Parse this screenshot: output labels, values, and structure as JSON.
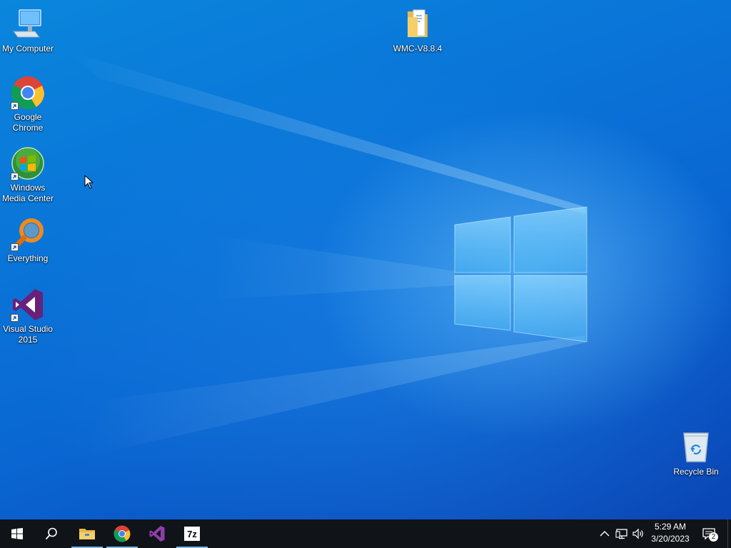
{
  "desktop": {
    "icons": [
      {
        "name": "my-computer",
        "label": "My Computer",
        "icon": "computer-icon"
      },
      {
        "name": "google-chrome",
        "label": "Google\nChrome",
        "icon": "chrome-icon"
      },
      {
        "name": "windows-media-center",
        "label": "Windows\nMedia Center",
        "icon": "windows-media-center-icon"
      },
      {
        "name": "everything",
        "label": "Everything",
        "icon": "magnifier-icon"
      },
      {
        "name": "visual-studio-2015",
        "label": "Visual Studio\n2015",
        "icon": "visual-studio-icon"
      },
      {
        "name": "wmc-folder",
        "label": "WMC-V8.8.4",
        "icon": "folder-icon"
      },
      {
        "name": "recycle-bin",
        "label": "Recycle Bin",
        "icon": "recycle-bin-icon"
      }
    ],
    "wallpaper_color": "#0a6fd6"
  },
  "taskbar": {
    "start_icon": "windows-logo-icon",
    "search_icon": "search-icon",
    "pinned": [
      {
        "name": "file-explorer",
        "icon": "folder-icon",
        "running": true
      },
      {
        "name": "google-chrome",
        "icon": "chrome-icon",
        "running": true
      },
      {
        "name": "visual-studio",
        "icon": "visual-studio-icon",
        "running": false
      },
      {
        "name": "7-zip",
        "icon": "7zip-icon",
        "running": true
      }
    ],
    "seven_zip_text": "7z",
    "tray": {
      "chevron_icon": "chevron-up-icon",
      "network_icon": "network-icon",
      "volume_icon": "speaker-icon"
    },
    "clock": {
      "time": "5:29 AM",
      "date": "3/20/2023"
    },
    "notifications": {
      "count": "2",
      "icon": "action-center-icon"
    },
    "accent_color": "#76b9ed",
    "background_color": "#101418"
  }
}
